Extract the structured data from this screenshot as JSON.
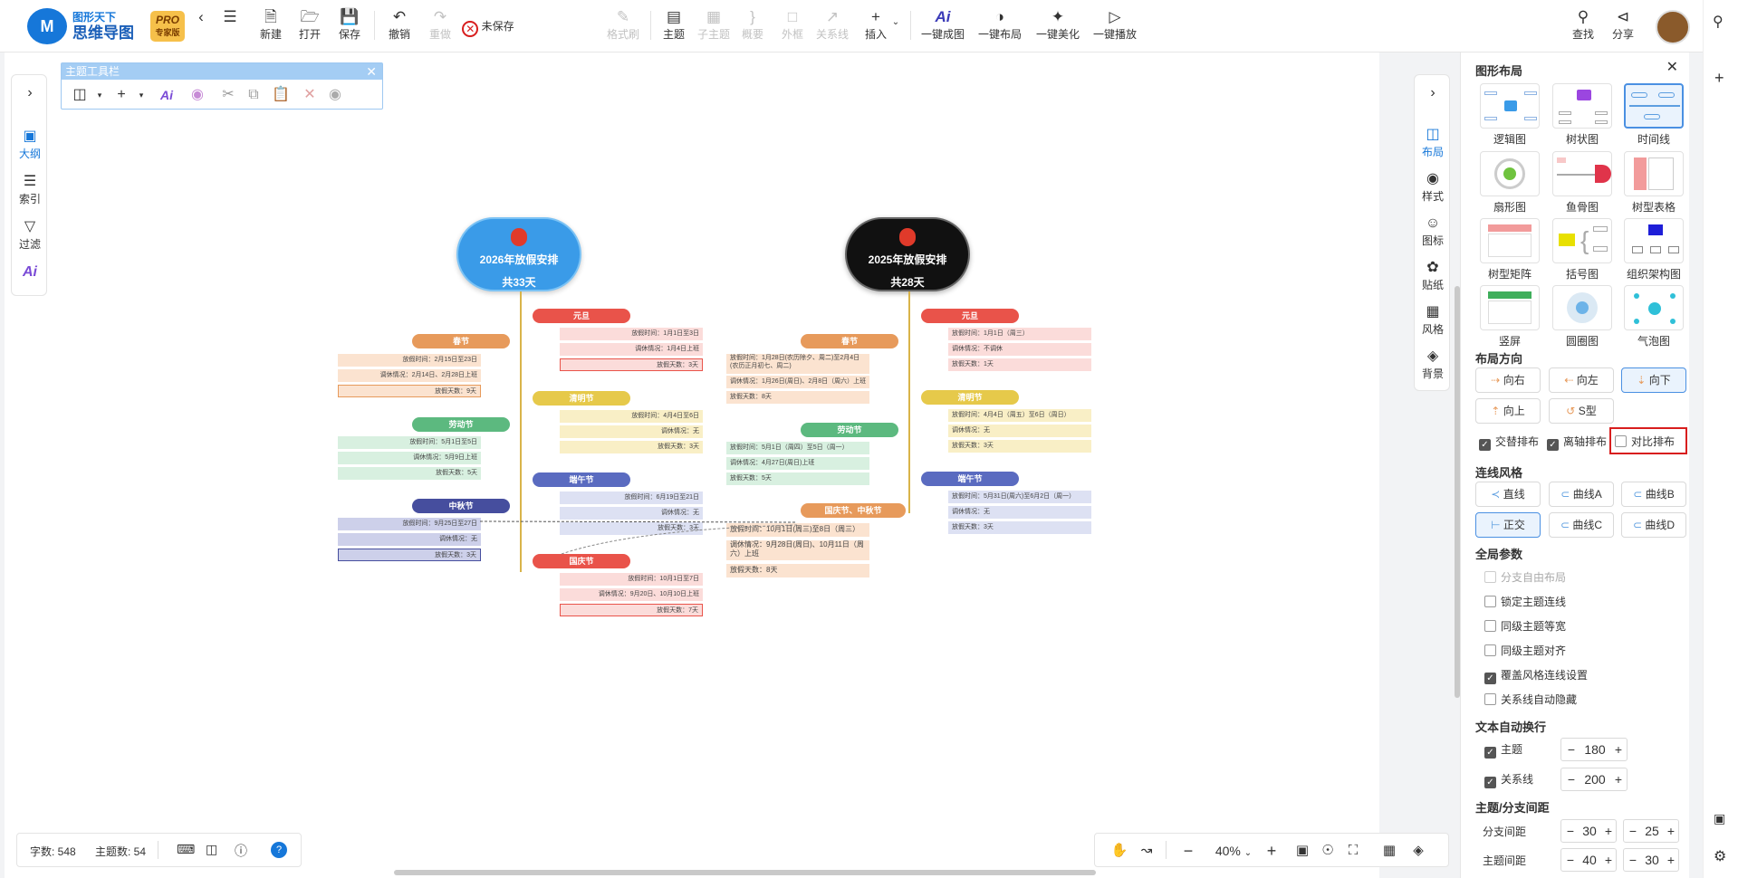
{
  "app": {
    "brand_line1": "图形天下",
    "brand_line2": "思维导图",
    "pro_badge": "PRO",
    "pro_sub": "专家版",
    "logo_letter": "M"
  },
  "toolbar": {
    "new": "新建",
    "open": "打开",
    "save": "保存",
    "undo": "撤销",
    "redo": "重做",
    "unsaved": "未保存",
    "format_brush": "格式刷",
    "topic": "主题",
    "subtopic": "子主题",
    "summary": "概要",
    "boundary": "外框",
    "relation": "关系线",
    "insert": "插入",
    "ai_map": "一键成图",
    "one_layout": "一键布局",
    "one_beautify": "一键美化",
    "one_play": "一键播放",
    "search": "查找",
    "share": "分享"
  },
  "left_rail": {
    "outline": "大纲",
    "index": "索引",
    "filter": "过滤"
  },
  "topic_toolbar": {
    "title": "主题工具栏"
  },
  "right_rail": {
    "layout": "布局",
    "style": "样式",
    "icon": "图标",
    "sticker": "贴纸",
    "theme": "风格",
    "background": "背景"
  },
  "panel": {
    "title": "图形布局",
    "layouts": [
      "逻辑图",
      "树状图",
      "时间线",
      "扇形图",
      "鱼骨图",
      "树型表格",
      "树型矩阵",
      "括号图",
      "组织架构图",
      "竖屏",
      "圆圈图",
      "气泡图"
    ],
    "selected_layout": "时间线",
    "direction_title": "布局方向",
    "directions": [
      "向右",
      "向左",
      "向下",
      "向上",
      "S型"
    ],
    "selected_direction": "向下",
    "options": {
      "alternate": "交替排布",
      "axis": "离轴排布",
      "compare": "对比排布"
    },
    "line_style_title": "连线风格",
    "line_styles": [
      "直线",
      "曲线A",
      "曲线B",
      "正交",
      "曲线C",
      "曲线D"
    ],
    "selected_line_style": "正交",
    "global_title": "全局参数",
    "global_options": [
      "分支自由布局",
      "锁定主题连线",
      "同级主题等宽",
      "同级主题对齐",
      "覆盖风格连线设置",
      "关系线自动隐藏"
    ],
    "wrap_title": "文本自动换行",
    "wrap_topic_label": "主题",
    "wrap_topic_value": "180",
    "wrap_relation_label": "关系线",
    "wrap_relation_value": "200",
    "spacing_title": "主题/分支间距",
    "branch_spacing_label": "分支间距",
    "branch_spacing_h": "30",
    "branch_spacing_v": "25",
    "topic_spacing_label": "主题间距",
    "topic_spacing_h": "40",
    "topic_spacing_v": "30"
  },
  "status": {
    "word_count": "字数: 548",
    "topic_count": "主题数: 54"
  },
  "zoom": {
    "level": "40%"
  },
  "mindmap": {
    "root_left": {
      "line1": "2026年放假安排",
      "line2": "共33天"
    },
    "root_right": {
      "line1": "2025年放假安排",
      "line2": "共28天"
    },
    "left": [
      {
        "title": "元旦",
        "leaves": [
          "放假时间：1月1日至3日",
          "调休情况：1月4日上班",
          "放假天数：3天"
        ]
      },
      {
        "title": "春节",
        "leaves": [
          "放假时间：2月15日至23日",
          "调休情况：2月14日、2月28日上班",
          "放假天数：9天"
        ]
      },
      {
        "title": "清明节",
        "leaves": [
          "放假时间：4月4日至6日",
          "调休情况：无",
          "放假天数：3天"
        ]
      },
      {
        "title": "劳动节",
        "leaves": [
          "放假时间：5月1日至5日",
          "调休情况：5月9日上班",
          "放假天数：5天"
        ]
      },
      {
        "title": "端午节",
        "leaves": [
          "放假时间：6月19日至21日",
          "调休情况：无",
          "放假天数：3天"
        ]
      },
      {
        "title": "中秋节",
        "leaves": [
          "放假时间：9月25日至27日",
          "调休情况：无",
          "放假天数：3天"
        ]
      },
      {
        "title": "国庆节",
        "leaves": [
          "放假时间：10月1日至7日",
          "调休情况：9月20日、10月10日上班",
          "放假天数：7天"
        ]
      }
    ],
    "right": [
      {
        "title": "元旦",
        "leaves": [
          "放假时间：1月1日（周三）",
          "调休情况：不调休",
          "放假天数：1天"
        ]
      },
      {
        "title": "春节",
        "leaves": [
          "放假时间：1月28日(农历除夕、周二)至2月4日(农历正月初七、周二)",
          "调休情况：1月26日(周日)、2月8日（周六）上班",
          "放假天数：8天"
        ]
      },
      {
        "title": "清明节",
        "leaves": [
          "放假时间：4月4日（周五）至6日（周日）",
          "调休情况：无",
          "放假天数：3天"
        ]
      },
      {
        "title": "劳动节",
        "leaves": [
          "放假时间：5月1日（周四）至5日（周一）",
          "调休情况：4月27日(周日)上班",
          "放假天数：5天"
        ]
      },
      {
        "title": "端午节",
        "leaves": [
          "放假时间：5月31日(周六)至6月2日（周一）",
          "调休情况：无",
          "放假天数：3天"
        ]
      },
      {
        "title": "国庆节、中秋节",
        "leaves": [
          "放假时间：10月1日(周三)至8日（周三）",
          "调休情况：9月28日(周日)、10月11日（周六）上班",
          "放假天数：8天"
        ]
      }
    ]
  }
}
